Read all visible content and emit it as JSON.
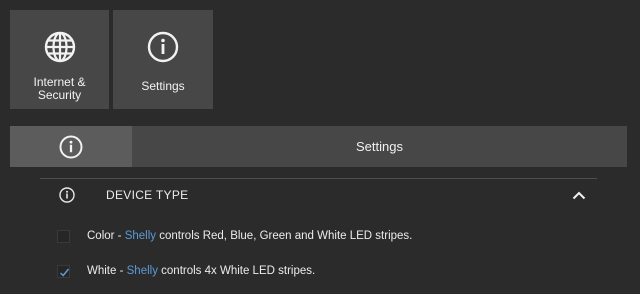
{
  "tiles": [
    {
      "label": "Internet &\nSecurity",
      "icon": "globe-icon"
    },
    {
      "label": "Settings",
      "icon": "info-icon"
    }
  ],
  "tabbar": {
    "title": "Settings",
    "icon": "info-icon"
  },
  "section": {
    "title": "DEVICE TYPE",
    "icon": "info-icon",
    "toggle_icon": "chevron-up-icon",
    "expanded": true
  },
  "options": [
    {
      "type": "Color",
      "sep": " - ",
      "brand": "Shelly",
      "desc": " controls Red, Blue, Green and White LED stripes.",
      "checked": false
    },
    {
      "type": "White",
      "sep": " - ",
      "brand": "Shelly",
      "desc": " controls 4x White LED stripes.",
      "checked": true
    }
  ],
  "colors": {
    "background": "#2b2b2b",
    "tile": "#474747",
    "active_tab": "#5c5c5c",
    "brand": "#5b9bd5",
    "checkmark": "#5b9bd5"
  }
}
